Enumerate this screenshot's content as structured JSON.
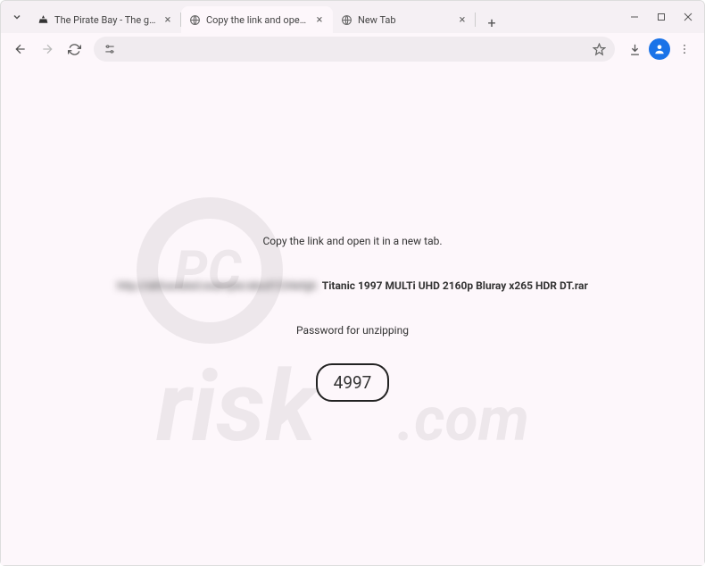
{
  "tabs": [
    {
      "title": "The Pirate Bay - The galaxy's m…",
      "favicon": "ship"
    },
    {
      "title": "Copy the link and open it in a n…",
      "favicon": "globe"
    },
    {
      "title": "New Tab",
      "favicon": "globe"
    }
  ],
  "active_tab_index": 1,
  "page": {
    "instruction": "Copy the link and open it in a new tab.",
    "blurred_link": "http://obfuscated.example/abcd1234efgh",
    "filename": "Titanic 1997 MULTi UHD 2160p Bluray x265 HDR DT.rar",
    "password_label": "Password for unzipping",
    "password_value": "4997"
  },
  "watermark_text": "PCrisk.com"
}
